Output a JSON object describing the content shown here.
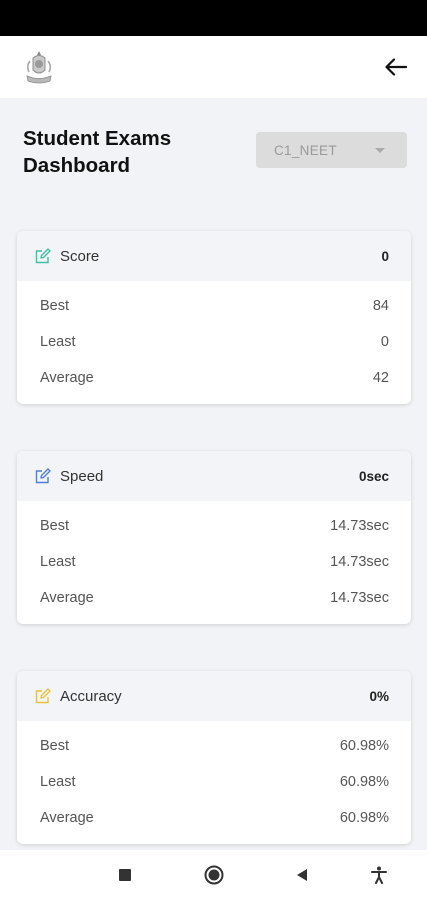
{
  "header": {
    "title_line1": "Student Exams",
    "title_line2": "Dashboard",
    "exam_select_value": "C1_NEET"
  },
  "cards": [
    {
      "title": "Score",
      "total": "0",
      "icon": "edit-square-icon",
      "color": "#3fbfa4",
      "rows": [
        {
          "label": "Best",
          "value": "84"
        },
        {
          "label": "Least",
          "value": "0"
        },
        {
          "label": "Average",
          "value": "42"
        }
      ]
    },
    {
      "title": "Speed",
      "total": "0sec",
      "icon": "edit-square-icon",
      "color": "#4f7fd9",
      "rows": [
        {
          "label": "Best",
          "value": "14.73sec"
        },
        {
          "label": "Least",
          "value": "14.73sec"
        },
        {
          "label": "Average",
          "value": "14.73sec"
        }
      ]
    },
    {
      "title": "Accuracy",
      "total": "0%",
      "icon": "edit-square-icon",
      "color": "#e8c23a",
      "rows": [
        {
          "label": "Best",
          "value": "60.98%"
        },
        {
          "label": "Least",
          "value": "60.98%"
        },
        {
          "label": "Average",
          "value": "60.98%"
        }
      ]
    }
  ],
  "nav": {
    "icons": [
      "stop-square-icon",
      "home-circle-icon",
      "back-triangle-icon",
      "accessibility-icon"
    ]
  }
}
